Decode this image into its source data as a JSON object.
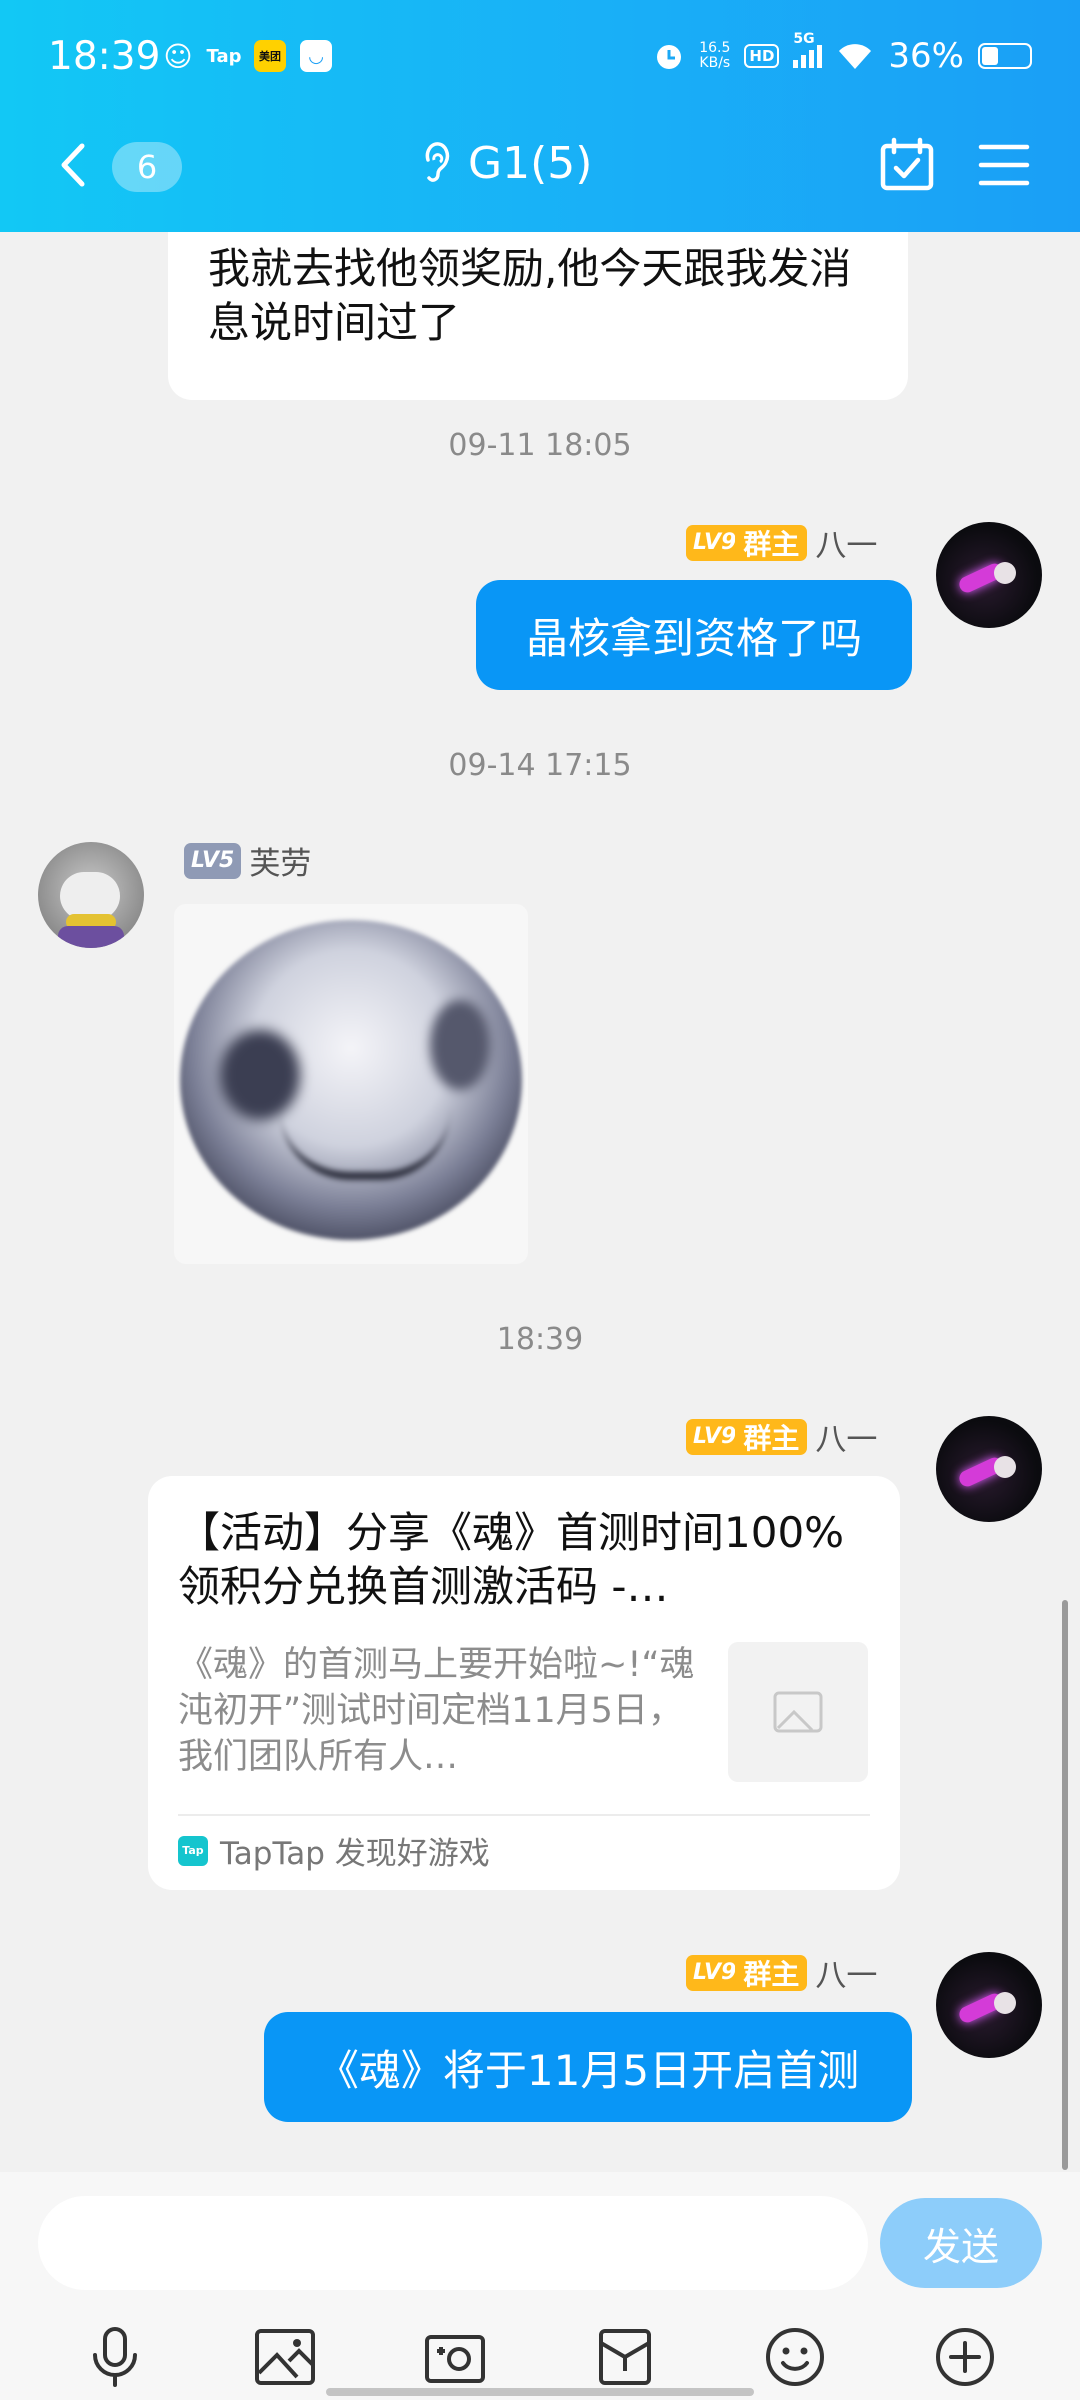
{
  "status_bar": {
    "time": "18:39",
    "speed_value": "16.5",
    "speed_unit": "KB/s",
    "hd": "HD",
    "net": "5G",
    "battery": "36%",
    "notif_tap": "Tap",
    "notif_meituan": "美团"
  },
  "nav": {
    "unread_count": "6",
    "title": "G1(5)"
  },
  "messages": {
    "m0_text": "我就去找他领奖励,他今天跟我发消息说时间过了",
    "stamp1": "09-11 18:05",
    "m1": {
      "level": "LV9",
      "role": "群主",
      "name": "八一",
      "text": "晶核拿到资格了吗"
    },
    "stamp2": "09-14 17:15",
    "m2": {
      "level": "LV5",
      "name": "芙劳"
    },
    "stamp3": "18:39",
    "m3": {
      "level": "LV9",
      "role": "群主",
      "name": "八一",
      "card_title": "【活动】分享《魂》首测时间100%领积分兑换首测激活码 -…",
      "card_desc": "《魂》的首测马上要开始啦~!“魂沌初开”测试时间定档11月5日，我们团队所有人…",
      "source_logo": "Tap",
      "card_source": "TapTap 发现好游戏"
    },
    "m4": {
      "level": "LV9",
      "role": "群主",
      "name": "八一",
      "text": "《魂》将于11月5日开启首测"
    }
  },
  "input": {
    "placeholder": "",
    "send_label": "发送"
  },
  "colors": {
    "header_start": "#12c8f5",
    "header_end": "#1a9ff6",
    "bubble_blue": "#0996f6",
    "badge_gold": "#ffb81a",
    "send_btn": "#8dcdfa"
  }
}
